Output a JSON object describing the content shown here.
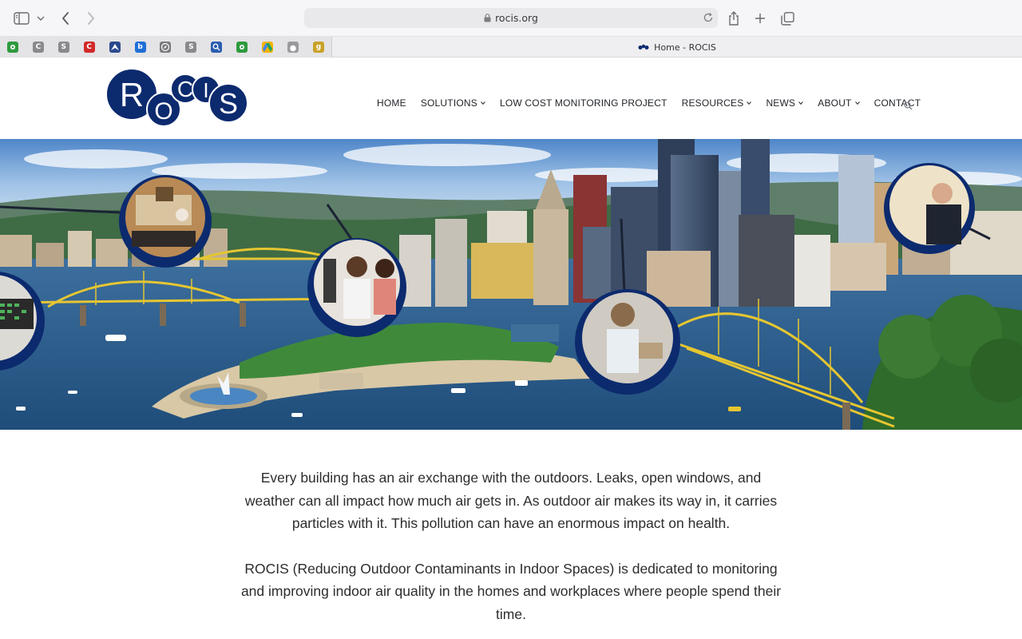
{
  "browser": {
    "url": "rocis.org",
    "tab_title": "Home - ROCIS",
    "favorites": [
      {
        "icon": "green-gear-icon",
        "letter": "",
        "color": "#2e9b3e"
      },
      {
        "icon": "c-letter-icon",
        "letter": "C",
        "color": "#8a8a8e"
      },
      {
        "icon": "s-letter-icon",
        "letter": "S",
        "color": "#8a8a8e"
      },
      {
        "icon": "red-c-icon",
        "letter": "C",
        "color": "#d12a2a"
      },
      {
        "icon": "arrow-logo-icon",
        "letter": "",
        "color": "#2b4a8c"
      },
      {
        "icon": "bing-icon",
        "letter": "b",
        "color": "#1f6fd6"
      },
      {
        "icon": "compass-icon",
        "letter": "",
        "color": "#7a7a7e"
      },
      {
        "icon": "s-letter-icon",
        "letter": "S",
        "color": "#8a8a8e"
      },
      {
        "icon": "search-icon",
        "letter": "",
        "color": "#2a5db0"
      },
      {
        "icon": "green-gear-icon",
        "letter": "",
        "color": "#2e9b3e"
      },
      {
        "icon": "google-drive-icon",
        "letter": "",
        "color": "#f4b400"
      },
      {
        "icon": "apple-icon",
        "letter": "",
        "color": "#9a9a9e"
      },
      {
        "icon": "g-letter-icon",
        "letter": "g",
        "color": "#c9a227"
      }
    ]
  },
  "site": {
    "logo_letters": [
      "R",
      "O",
      "C",
      "I",
      "S"
    ],
    "brand_color": "#0c2a6e",
    "nav": [
      {
        "label": "HOME",
        "has_caret": false
      },
      {
        "label": "SOLUTIONS",
        "has_caret": true
      },
      {
        "label": "LOW COST MONITORING PROJECT",
        "has_caret": false
      },
      {
        "label": "RESOURCES",
        "has_caret": true
      },
      {
        "label": "NEWS",
        "has_caret": true
      },
      {
        "label": "ABOUT",
        "has_caret": true
      },
      {
        "label": "CONTACT",
        "has_caret": false
      }
    ]
  },
  "intro": {
    "paragraph_1": "Every building has an air exchange with the outdoors. Leaks, open windows, and weather can all impact how much air gets in. As outdoor air makes its way in, it carries particles with it. This pollution can have an enormous impact on health.",
    "paragraph_2": "ROCIS (Reducing Outdoor Contaminants in Indoor Spaces) is dedicated to monitoring and improving indoor air quality in the homes and workplaces where people spend their time."
  }
}
